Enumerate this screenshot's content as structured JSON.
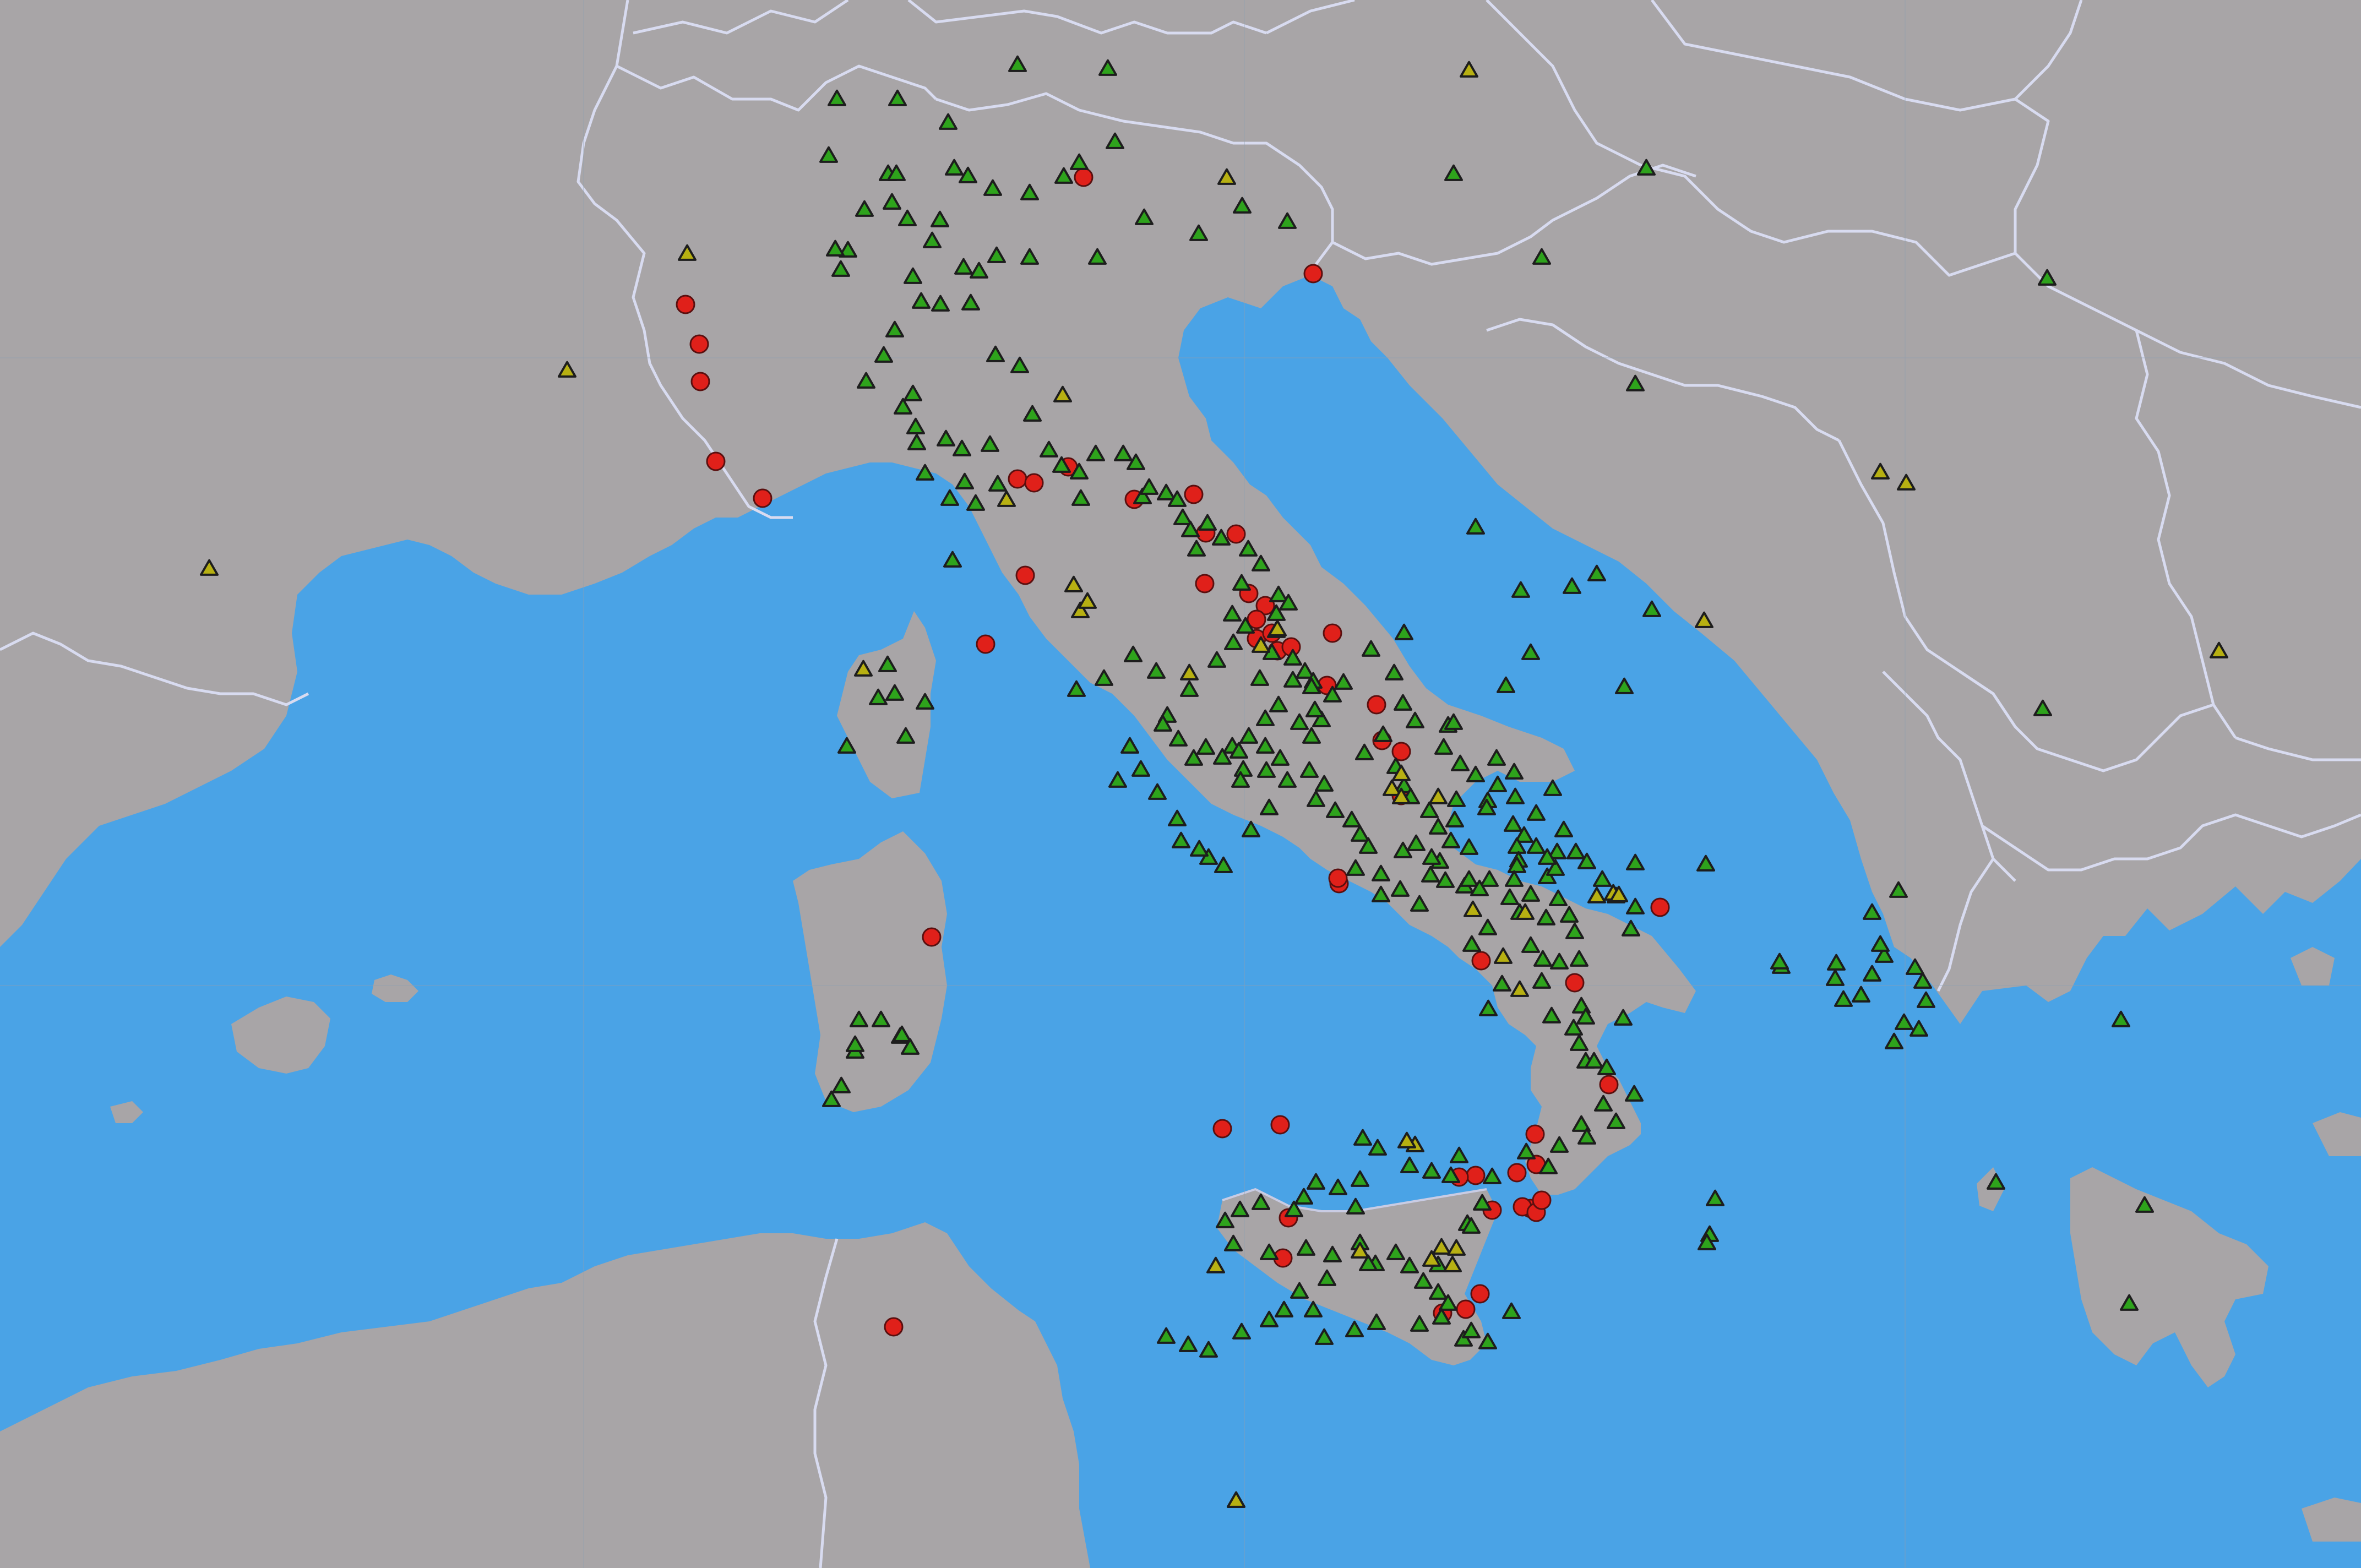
{
  "colors": {
    "sea": "#4aa3e6",
    "land": "#a8a5a7",
    "border": "#d8dbf0",
    "station_green": "#2ea31c",
    "station_yellow": "#b7b012",
    "event_red": "#e0201a"
  },
  "legend": {},
  "markers": {
    "green_triangles": [
      [
        2012,
        127
      ],
      [
        1630,
        182
      ],
      [
        1848,
        120
      ],
      [
        1722,
        225
      ],
      [
        2025,
        260
      ],
      [
        1758,
        322
      ],
      [
        2078,
        398
      ],
      [
        1960,
        298
      ],
      [
        2338,
        405
      ],
      [
        2177,
        427
      ],
      [
        2256,
        377
      ],
      [
        1505,
        285
      ],
      [
        1733,
        308
      ],
      [
        1932,
        323
      ],
      [
        1803,
        345
      ],
      [
        1870,
        353
      ],
      [
        1993,
        470
      ],
      [
        1870,
        470
      ],
      [
        1778,
        495
      ],
      [
        1810,
        467
      ],
      [
        1540,
        457
      ],
      [
        1613,
        318
      ],
      [
        1620,
        370
      ],
      [
        1648,
        400
      ],
      [
        1693,
        440
      ],
      [
        1707,
        402
      ],
      [
        1673,
        550
      ],
      [
        1750,
        488
      ],
      [
        1763,
        553
      ],
      [
        1708,
        555
      ],
      [
        1658,
        505
      ],
      [
        1570,
        383
      ],
      [
        1517,
        455
      ],
      [
        1527,
        492
      ],
      [
        1625,
        602
      ],
      [
        1605,
        648
      ],
      [
        1573,
        695
      ],
      [
        1658,
        718
      ],
      [
        1665,
        807
      ],
      [
        1747,
        818
      ],
      [
        1798,
        810
      ],
      [
        1875,
        755
      ],
      [
        1852,
        667
      ],
      [
        1808,
        647
      ],
      [
        1718,
        800
      ],
      [
        1640,
        742
      ],
      [
        1663,
        778
      ],
      [
        1680,
        862
      ],
      [
        1725,
        908
      ],
      [
        1752,
        878
      ],
      [
        1772,
        917
      ],
      [
        1812,
        882
      ],
      [
        1905,
        820
      ],
      [
        1928,
        848
      ],
      [
        1963,
        908
      ],
      [
        1960,
        860
      ],
      [
        1990,
        827
      ],
      [
        2040,
        827
      ],
      [
        2063,
        843
      ],
      [
        2075,
        905
      ],
      [
        2087,
        888
      ],
      [
        2118,
        898
      ],
      [
        2138,
        910
      ],
      [
        2148,
        943
      ],
      [
        2162,
        965
      ],
      [
        2193,
        953
      ],
      [
        2173,
        1000
      ],
      [
        2218,
        980
      ],
      [
        2267,
        1000
      ],
      [
        2290,
        1027
      ],
      [
        2255,
        1062
      ],
      [
        2322,
        1083
      ],
      [
        2340,
        1098
      ],
      [
        2318,
        1148
      ],
      [
        2310,
        1188
      ],
      [
        2348,
        1198
      ],
      [
        2370,
        1222
      ],
      [
        2385,
        1240
      ],
      [
        2348,
        1238
      ],
      [
        2322,
        1283
      ],
      [
        2298,
        1308
      ],
      [
        2268,
        1340
      ],
      [
        2238,
        1358
      ],
      [
        2220,
        1378
      ],
      [
        2258,
        1400
      ],
      [
        2300,
        1402
      ],
      [
        2338,
        1420
      ],
      [
        2378,
        1402
      ],
      [
        2405,
        1427
      ],
      [
        2390,
        1455
      ],
      [
        2425,
        1475
      ],
      [
        2455,
        1492
      ],
      [
        2470,
        1518
      ],
      [
        2485,
        1540
      ],
      [
        2462,
        1580
      ],
      [
        2508,
        1590
      ],
      [
        2508,
        1628
      ],
      [
        2543,
        1618
      ],
      [
        2578,
        1645
      ],
      [
        2625,
        1602
      ],
      [
        2615,
        1567
      ],
      [
        2572,
        1535
      ],
      [
        2548,
        1548
      ],
      [
        2598,
        1592
      ],
      [
        2660,
        1612
      ],
      [
        2705,
        1600
      ],
      [
        2742,
        1633
      ],
      [
        2780,
        1627
      ],
      [
        2810,
        1595
      ],
      [
        2825,
        1580
      ],
      [
        2760,
        1660
      ],
      [
        2702,
        1688
      ],
      [
        2673,
        1718
      ],
      [
        2780,
        1720
      ],
      [
        2802,
        1745
      ],
      [
        2800,
        1785
      ],
      [
        2818,
        1848
      ],
      [
        2858,
        1870
      ],
      [
        2868,
        1898
      ],
      [
        2880,
        1930
      ],
      [
        2918,
        1942
      ],
      [
        2968,
        1990
      ],
      [
        2912,
        2008
      ],
      [
        2872,
        2045
      ],
      [
        2882,
        2068
      ],
      [
        2832,
        2083
      ],
      [
        2812,
        2122
      ],
      [
        2772,
        2095
      ],
      [
        2710,
        2140
      ],
      [
        2692,
        2188
      ],
      [
        2665,
        2225
      ],
      [
        2635,
        2138
      ],
      [
        2600,
        2130
      ],
      [
        2560,
        2120
      ],
      [
        2502,
        2088
      ],
      [
        2475,
        2070
      ],
      [
        2470,
        2145
      ],
      [
        2430,
        2160
      ],
      [
        2390,
        2150
      ],
      [
        2368,
        2177
      ],
      [
        2350,
        2200
      ],
      [
        2290,
        2187
      ],
      [
        2252,
        2200
      ],
      [
        2225,
        2220
      ],
      [
        2240,
        2262
      ],
      [
        2305,
        2278
      ],
      [
        2372,
        2270
      ],
      [
        2420,
        2282
      ],
      [
        2470,
        2260
      ],
      [
        2498,
        2298
      ],
      [
        2535,
        2278
      ],
      [
        2560,
        2302
      ],
      [
        2585,
        2330
      ],
      [
        2612,
        2350
      ],
      [
        2630,
        2370
      ],
      [
        2618,
        2395
      ],
      [
        2578,
        2408
      ],
      [
        2500,
        2405
      ],
      [
        2460,
        2418
      ],
      [
        2405,
        2432
      ],
      [
        2385,
        2382
      ],
      [
        2410,
        2325
      ],
      [
        2360,
        2348
      ],
      [
        2332,
        2382
      ],
      [
        2305,
        2400
      ],
      [
        2255,
        2422
      ],
      [
        2195,
        2455
      ],
      [
        2158,
        2445
      ],
      [
        2118,
        2430
      ],
      [
        1510,
        2000
      ],
      [
        1528,
        1975
      ],
      [
        1553,
        1912
      ],
      [
        1553,
        1900
      ],
      [
        1635,
        1885
      ],
      [
        1638,
        1882
      ],
      [
        1560,
        1855
      ],
      [
        1600,
        1855
      ],
      [
        1653,
        1905
      ],
      [
        1538,
        1358
      ],
      [
        1595,
        1270
      ],
      [
        1612,
        1210
      ],
      [
        1625,
        1262
      ],
      [
        1680,
        1278
      ],
      [
        1645,
        1340
      ],
      [
        1730,
        1020
      ],
      [
        1955,
        1255
      ],
      [
        2005,
        1235
      ],
      [
        2058,
        1192
      ],
      [
        2100,
        1222
      ],
      [
        2120,
        1302
      ],
      [
        2140,
        1345
      ],
      [
        2168,
        1380
      ],
      [
        2190,
        1360
      ],
      [
        2250,
        1367
      ],
      [
        2325,
        1380
      ],
      [
        2382,
        1340
      ],
      [
        2400,
        1310
      ],
      [
        2420,
        1265
      ],
      [
        2388,
        1292
      ],
      [
        2360,
        1315
      ],
      [
        2298,
        1358
      ],
      [
        2253,
        1420
      ],
      [
        2305,
        1470
      ],
      [
        2272,
        1510
      ],
      [
        2222,
        1575
      ],
      [
        2195,
        1560
      ],
      [
        2178,
        1545
      ],
      [
        2145,
        1530
      ],
      [
        2138,
        1490
      ],
      [
        2102,
        1442
      ],
      [
        2072,
        1400
      ],
      [
        2030,
        1420
      ],
      [
        2052,
        1358
      ],
      [
        2112,
        1318
      ],
      [
        2160,
        1255
      ],
      [
        2210,
        1202
      ],
      [
        2240,
        1170
      ],
      [
        2262,
        1140
      ],
      [
        2238,
        1118
      ],
      [
        2318,
        1117
      ],
      [
        2288,
        1235
      ],
      [
        2382,
        1250
      ],
      [
        2440,
        1242
      ],
      [
        2490,
        1182
      ],
      [
        2550,
        1152
      ],
      [
        2532,
        1225
      ],
      [
        2548,
        1280
      ],
      [
        2512,
        1337
      ],
      [
        2478,
        1370
      ],
      [
        2535,
        1395
      ],
      [
        2550,
        1430
      ],
      [
        2562,
        1450
      ],
      [
        2596,
        1475
      ],
      [
        2612,
        1505
      ],
      [
        2642,
        1492
      ],
      [
        2680,
        1410
      ],
      [
        2652,
        1390
      ],
      [
        2622,
        1360
      ],
      [
        2630,
        1320
      ],
      [
        2570,
        1312
      ],
      [
        2645,
        1455
      ],
      [
        2702,
        1457
      ],
      [
        2720,
        1428
      ],
      [
        2752,
        1450
      ],
      [
        2790,
        1480
      ],
      [
        2820,
        1435
      ],
      [
        2790,
        1540
      ],
      [
        2768,
        1520
      ],
      [
        2748,
        1500
      ],
      [
        2668,
        1542
      ],
      [
        2668,
        1600
      ],
      [
        2687,
        1617
      ],
      [
        2718,
        1380
      ],
      [
        2750,
        1405
      ],
      [
        2600,
        1560
      ],
      [
        2635,
        1530
      ],
      [
        2700,
        1470
      ],
      [
        2755,
        1540
      ],
      [
        2758,
        1565
      ],
      [
        2830,
        1635
      ],
      [
        2850,
        1665
      ],
      [
        2860,
        1695
      ],
      [
        2868,
        1745
      ],
      [
        2872,
        1830
      ],
      [
        2880,
        1850
      ],
      [
        2895,
        1930
      ],
      [
        2935,
        2040
      ],
      [
        2948,
        1852
      ],
      [
        2882,
        1568
      ],
      [
        2862,
        1550
      ],
      [
        2828,
        1550
      ],
      [
        2755,
        1575
      ],
      [
        2750,
        1600
      ],
      [
        2808,
        1670
      ],
      [
        2832,
        1750
      ],
      [
        2910,
        1600
      ],
      [
        2970,
        1570
      ],
      [
        2962,
        1690
      ],
      [
        2970,
        1650
      ],
      [
        3098,
        1572
      ],
      [
        3235,
        1758
      ],
      [
        3232,
        1750
      ],
      [
        3115,
        2180
      ],
      [
        3105,
        2245
      ],
      [
        3100,
        2260
      ],
      [
        2658,
        2435
      ],
      [
        2702,
        2440
      ],
      [
        2745,
        2385
      ],
      [
        2612,
        2300
      ],
      [
        2485,
        2298
      ],
      [
        2462,
        2195
      ],
      [
        2672,
        2420
      ],
      [
        2672,
        2230
      ],
      [
        2703,
        1835
      ],
      [
        2728,
        1790
      ],
      [
        2650,
        2102
      ],
      [
        2810,
        1560
      ],
      [
        2840,
        1510
      ],
      [
        2640,
        1315
      ],
      [
        3448,
        1620
      ],
      [
        3400,
        1660
      ],
      [
        3422,
        1738
      ],
      [
        3415,
        1718
      ],
      [
        3400,
        1772
      ],
      [
        3492,
        1785
      ],
      [
        3478,
        1760
      ],
      [
        3498,
        1820
      ],
      [
        3458,
        1860
      ],
      [
        3348,
        1818
      ],
      [
        3333,
        1780
      ],
      [
        3380,
        1810
      ],
      [
        3335,
        1752
      ],
      [
        3440,
        1895
      ],
      [
        3485,
        1872
      ],
      [
        3710,
        1290
      ],
      [
        3852,
        1855
      ],
      [
        3625,
        2150
      ],
      [
        3895,
        2192
      ],
      [
        3867,
        2370
      ],
      [
        3718,
        508
      ],
      [
        2762,
        1075
      ],
      [
        2735,
        1248
      ],
      [
        2780,
        1188
      ],
      [
        2680,
        960
      ],
      [
        2855,
        1068
      ],
      [
        3000,
        1110
      ],
      [
        2950,
        1250
      ],
      [
        2970,
        700
      ],
      [
        2800,
        470
      ],
      [
        2990,
        308
      ],
      [
        2640,
        318
      ],
      [
        2900,
        1045
      ],
      [
        1628,
        318
      ],
      [
        1520,
        182
      ]
    ],
    "yellow_triangles": [
      [
        2668,
        130
      ],
      [
        2228,
        325
      ],
      [
        1930,
        720
      ],
      [
        1828,
        910
      ],
      [
        1950,
        1065
      ],
      [
        1962,
        1112
      ],
      [
        1975,
        1095
      ],
      [
        1568,
        1218
      ],
      [
        2290,
        1175
      ],
      [
        2320,
        1145
      ],
      [
        2160,
        1225
      ],
      [
        2545,
        1408
      ],
      [
        2528,
        1435
      ],
      [
        2545,
        1450
      ],
      [
        2675,
        1655
      ],
      [
        2770,
        1660
      ],
      [
        2935,
        1630
      ],
      [
        2570,
        2082
      ],
      [
        2555,
        2075
      ],
      [
        2618,
        2268
      ],
      [
        2645,
        2270
      ],
      [
        2638,
        2300
      ],
      [
        2470,
        2275
      ],
      [
        2208,
        2302
      ],
      [
        2245,
        2728
      ],
      [
        2245,
        2728
      ],
      [
        3415,
        860
      ],
      [
        4030,
        1185
      ],
      [
        3462,
        880
      ],
      [
        3095,
        1130
      ],
      [
        2930,
        1625
      ],
      [
        1030,
        675
      ],
      [
        380,
        1035
      ],
      [
        2600,
        2290
      ],
      [
        2900,
        1630
      ],
      [
        2940,
        1628
      ],
      [
        2730,
        1740
      ],
      [
        2760,
        1800
      ],
      [
        2612,
        1450
      ],
      [
        1248,
        463
      ]
    ],
    "red_dots": [
      [
        1968,
        322
      ],
      [
        2385,
        497
      ],
      [
        1245,
        553
      ],
      [
        1270,
        625
      ],
      [
        1272,
        693
      ],
      [
        1300,
        838
      ],
      [
        1385,
        905
      ],
      [
        1848,
        870
      ],
      [
        1878,
        877
      ],
      [
        1940,
        848
      ],
      [
        2060,
        907
      ],
      [
        2168,
        898
      ],
      [
        2190,
        968
      ],
      [
        2245,
        970
      ],
      [
        2188,
        1060
      ],
      [
        2268,
        1078
      ],
      [
        2298,
        1100
      ],
      [
        2282,
        1125
      ],
      [
        2282,
        1160
      ],
      [
        2310,
        1150
      ],
      [
        2320,
        1182
      ],
      [
        2345,
        1175
      ],
      [
        2420,
        1150
      ],
      [
        2410,
        1245
      ],
      [
        2500,
        1280
      ],
      [
        2510,
        1345
      ],
      [
        2545,
        1365
      ],
      [
        2545,
        1445
      ],
      [
        2432,
        1605
      ],
      [
        2430,
        1595
      ],
      [
        2690,
        1745
      ],
      [
        2860,
        1785
      ],
      [
        3015,
        1648
      ],
      [
        1790,
        1170
      ],
      [
        1862,
        1045
      ],
      [
        2922,
        1970
      ],
      [
        2788,
        2060
      ],
      [
        2790,
        2115
      ],
      [
        2755,
        2130
      ],
      [
        2680,
        2135
      ],
      [
        2650,
        2138
      ],
      [
        2620,
        2385
      ],
      [
        2662,
        2378
      ],
      [
        2688,
        2350
      ],
      [
        2340,
        2212
      ],
      [
        2330,
        2285
      ],
      [
        2220,
        2050
      ],
      [
        2780,
        2195
      ],
      [
        2765,
        2192
      ],
      [
        1623,
        2410
      ],
      [
        2325,
        2043
      ],
      [
        1692,
        1702
      ],
      [
        2710,
        2198
      ],
      [
        2790,
        2202
      ],
      [
        2800,
        2180
      ]
    ]
  }
}
